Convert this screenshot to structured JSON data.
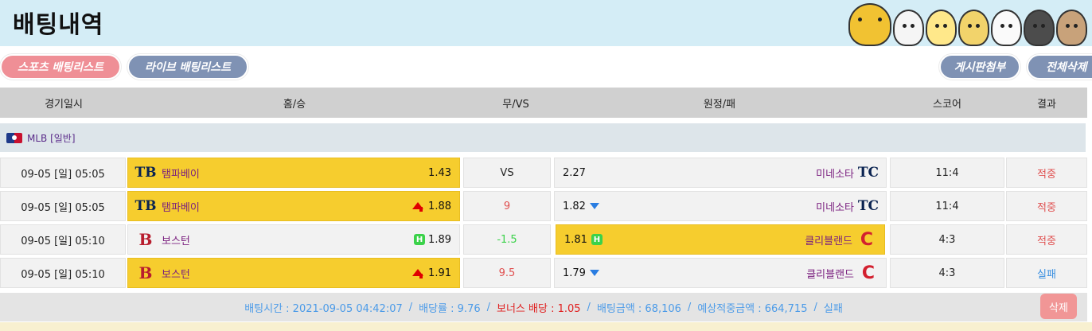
{
  "page": {
    "title": "배팅내역"
  },
  "buttons": {
    "sports_list": "스포츠 배팅리스트",
    "live_list": "라이브 배팅리스트",
    "board_attach": "게시판첨부",
    "delete_all": "전체삭제"
  },
  "columns": {
    "date": "경기일시",
    "home": "홈/승",
    "draw": "무/VS",
    "away": "원정/패",
    "score": "스코어",
    "result": "결과"
  },
  "league": {
    "name": "MLB [일반]"
  },
  "rows": [
    {
      "date": "09-05 [일] 05:05",
      "home_team": "탬파베이",
      "home_logo": "TB",
      "home_odds": "1.43",
      "draw": "VS",
      "away_odds": "2.27",
      "away_team": "미네소타",
      "away_logo": "TC",
      "score": "11:4",
      "result": "적중"
    },
    {
      "date": "09-05 [일] 05:05",
      "home_team": "탬파베이",
      "home_logo": "TB",
      "home_odds": "1.88",
      "draw": "9",
      "away_odds": "1.82",
      "away_team": "미네소타",
      "away_logo": "TC",
      "score": "11:4",
      "result": "적중"
    },
    {
      "date": "09-05 [일] 05:10",
      "home_team": "보스턴",
      "home_logo": "B",
      "home_odds": "1.89",
      "draw": "-1.5",
      "away_odds": "1.81",
      "away_team": "클리블랜드",
      "away_logo": "C",
      "score": "4:3",
      "result": "적중",
      "handicap_badge": "H"
    },
    {
      "date": "09-05 [일] 05:10",
      "home_team": "보스턴",
      "home_logo": "B",
      "home_odds": "1.91",
      "draw": "9.5",
      "away_odds": "1.79",
      "away_team": "클리블랜드",
      "away_logo": "C",
      "score": "4:3",
      "result": "실패"
    }
  ],
  "summary": {
    "bet_time": "배팅시간 : 2021-09-05 04:42:07",
    "bet_rate": "배당률 : 9.76",
    "bonus": "보너스 배당 : 1.05",
    "bet_amount": "배팅금액 : 68,106",
    "expected_win": "예상적중금액 : 664,715",
    "status": "실패",
    "separator": "/"
  },
  "delete_button": "삭제",
  "colors": {
    "win": "#e05050",
    "lose": "#3a8fe0",
    "highlight": "#f6cd2e",
    "pink": "#ef8f96",
    "slate": "#7f92b4"
  }
}
